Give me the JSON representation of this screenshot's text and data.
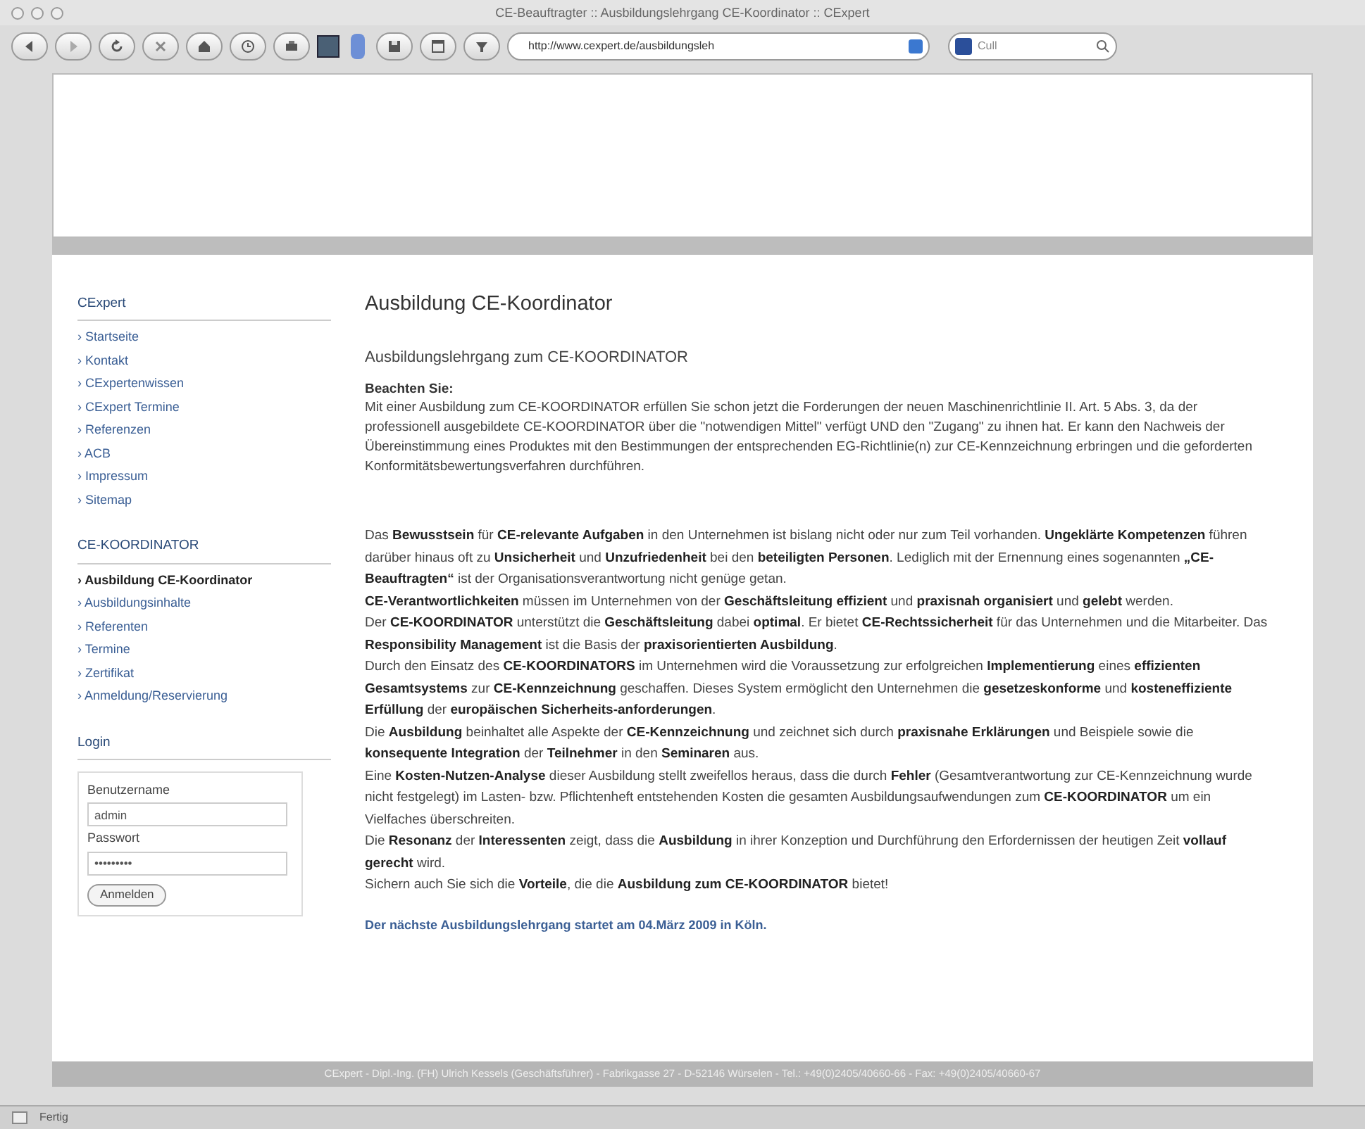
{
  "window": {
    "title": "CE-Beauftragter :: Ausbildungslehrgang CE-Koordinator :: CExpert"
  },
  "toolbar": {
    "url": "http://www.cexpert.de/ausbildungsleh",
    "search": "Cull"
  },
  "sidebar": [
    {
      "heading": "CExpert",
      "items": [
        {
          "label": "› Startseite",
          "selected": false
        },
        {
          "label": "› Kontakt",
          "selected": false
        },
        {
          "label": "› CExpertenwissen",
          "selected": false
        },
        {
          "label": "› CExpert Termine",
          "selected": false
        },
        {
          "label": "› Referenzen",
          "selected": false
        },
        {
          "label": "› ACB",
          "selected": false
        },
        {
          "label": "› Impressum",
          "selected": false
        },
        {
          "label": "› Sitemap",
          "selected": false
        }
      ]
    },
    {
      "heading": "CE-KOORDINATOR",
      "items": [
        {
          "label": "› Ausbildung CE-Koordinator",
          "selected": true
        },
        {
          "label": "› Ausbildungsinhalte",
          "selected": false
        },
        {
          "label": "› Referenten",
          "selected": false
        },
        {
          "label": "› Termine",
          "selected": false
        },
        {
          "label": "› Zertifikat",
          "selected": false
        },
        {
          "label": "› Anmeldung/Reservierung",
          "selected": false
        }
      ]
    }
  ],
  "login": {
    "heading": "Login",
    "username_label": "Benutzername",
    "username": "admin",
    "password_label": "Passwort",
    "password": "•••••••••",
    "button": "Anmelden"
  },
  "content": {
    "title": "Ausbildung CE-Koordinator",
    "subtitle": "Ausbildungslehrgang zum CE-KOORDINATOR",
    "notice_heading": "Beachten Sie:",
    "notice": "Mit einer Ausbildung zum CE-KOORDINATOR erfüllen Sie schon jetzt die Forderungen der neuen Maschinenrichtlinie II. Art. 5 Abs. 3, da der professionell ausgebildete CE-KOORDINATOR über die \"notwendigen Mittel\" verfügt UND den \"Zugang\" zu ihnen hat. Er kann den Nachweis der Übereinstimmung eines Produktes mit den Bestimmungen der entsprechenden EG-Richtlinie(n) zur CE-Kennzeichnung erbringen und die geforderten Konformitätsbewertungsverfahren durchführen.",
    "paragraphs": [
      "Das **Bewusstsein** für **CE-relevante Aufgaben** in den Unternehmen ist bislang nicht oder nur zum Teil vorhanden. **Ungeklärte Kompetenzen** führen darüber hinaus oft zu **Unsicherheit** und **Unzufriedenheit** bei den **beteiligten Personen**. Lediglich mit der Ernennung eines sogenannten **„CE-Beauftragten“** ist der Organisationsverantwortung nicht genüge getan.",
      "**CE-Verantwortlichkeiten** müssen im Unternehmen von der **Geschäftsleitung effizient** und **praxisnah organisiert** und **gelebt** werden.",
      "Der **CE-KOORDINATOR** unterstützt die **Geschäftsleitung** dabei **optimal**. Er bietet **CE-Rechtssicherheit** für das Unternehmen und die Mitarbeiter. Das **Responsibility Management** ist die Basis der **praxisorientierten Ausbildung**.",
      "Durch den Einsatz des **CE-KOORDINATORS** im Unternehmen wird die Voraussetzung zur erfolgreichen **Implementierung** eines **effizienten Gesamtsystems** zur **CE-Kennzeichnung** geschaffen. Dieses System ermöglicht den Unternehmen die **gesetzeskonforme** und **kosteneffiziente Erfüllung** der **europäischen Sicherheits-anforderungen**.",
      "Die **Ausbildung** beinhaltet alle Aspekte der **CE-Kennzeichnung** und zeichnet sich durch **praxisnahe Erklärungen** und Beispiele sowie die **konsequente Integration** der **Teilnehmer** in den **Seminaren** aus.",
      "Eine **Kosten-Nutzen-Analyse** dieser Ausbildung stellt zweifellos heraus, dass die durch **Fehler** (Gesamtverantwortung zur CE-Kennzeichnung wurde nicht festgelegt) im Lasten- bzw. Pflichtenheft entstehenden Kosten die gesamten Ausbildungsaufwendungen zum **CE-KOORDINATOR** um ein Vielfaches überschreiten.",
      "Die **Resonanz** der **Interessenten** zeigt, dass die **Ausbildung** in ihrer Konzeption und Durchführung den Erfordernissen der heutigen Zeit **vollauf gerecht** wird.",
      "Sichern auch Sie sich die **Vorteile**, die die **Ausbildung zum CE-KOORDINATOR** bietet!"
    ],
    "announcement": "Der nächste Ausbildungslehrgang startet am 04.März 2009 in Köln."
  },
  "footer": "CExpert - Dipl.-Ing. (FH) Ulrich Kessels (Geschäftsführer) - Fabrikgasse 27 - D-52146 Würselen - Tel.: +49(0)2405/40660-66 - Fax: +49(0)2405/40660-67",
  "status_bar": "Fertig"
}
